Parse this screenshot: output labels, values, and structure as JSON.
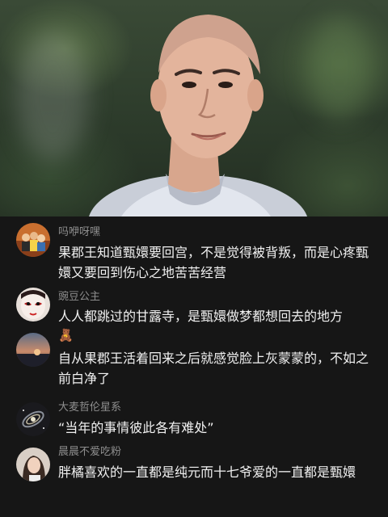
{
  "comments": [
    {
      "username": "吗咿呀嘿",
      "text": "果郡王知道甄嬛要回宫，不是觉得被背叛，而是心疼甄嬛又要回到伤心之地苦苦经营",
      "avatar_icon": "group-photo-avatar"
    },
    {
      "username": "豌豆公主",
      "text": "人人都跳过的甘露寺，是甄嬛做梦都想回去的地方",
      "avatar_icon": "opera-mask-avatar"
    },
    {
      "username": "",
      "emoji": "🧸",
      "text": "自从果郡王活着回来之后就感觉脸上灰蒙蒙的，不如之前白净了",
      "avatar_icon": "sunset-avatar"
    },
    {
      "username": "大麦哲伦星系",
      "text": "“当年的事情彼此各有难处”",
      "avatar_icon": "galaxy-avatar"
    },
    {
      "username": "晨晨不爱吃粉",
      "text": "胖橘喜欢的一直都是纯元而十七爷爱的一直都是甄嬛",
      "avatar_icon": "portrait-avatar"
    }
  ],
  "colors": {
    "background": "#161616",
    "username": "#8e8e8e",
    "text": "#f1f1f1"
  }
}
